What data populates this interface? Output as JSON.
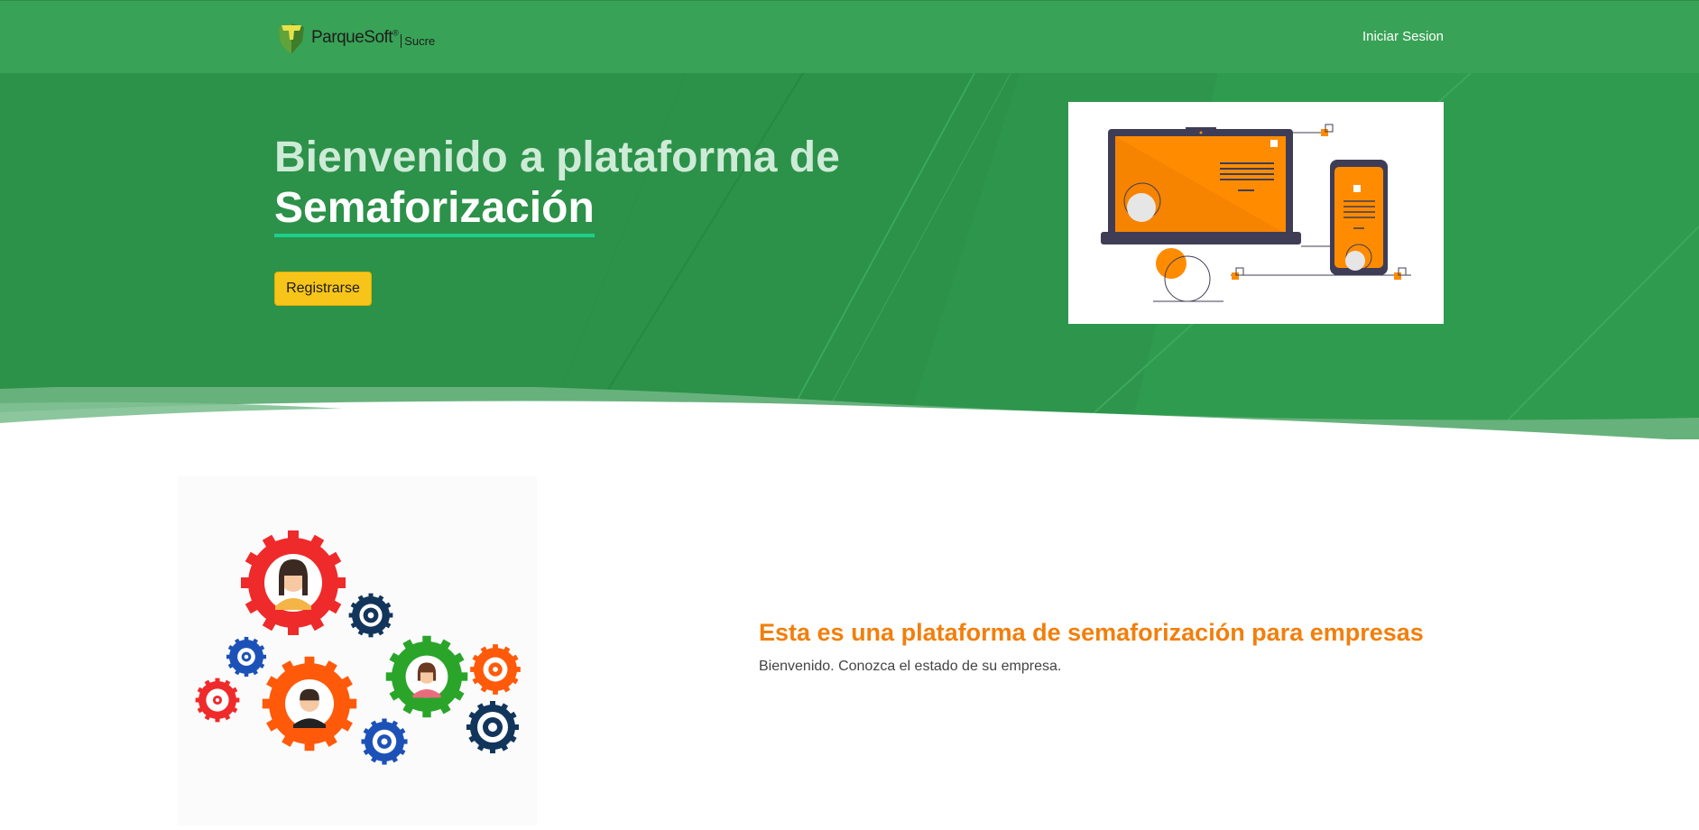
{
  "nav": {
    "brand_name": "ParqueSoft",
    "brand_reg": "®",
    "brand_sub": "Sucre",
    "login_label": "Iniciar Sesion"
  },
  "hero": {
    "title_line1": "Bienvenido a plataforma de",
    "title_line2": "Semaforización",
    "register_label": "Registrarse"
  },
  "info": {
    "title": "Esta es una plataforma de semaforización para empresas",
    "text": "Bienvenido. Conozca el estado de su empresa."
  },
  "colors": {
    "nav_green": "#38a356",
    "hero_green": "#2c9149",
    "accent_orange": "#f27f0c",
    "button_yellow": "#f7c51a",
    "underline_green": "#1ecf8c"
  },
  "icons": [
    "parquesoft-logo-icon",
    "devices-illustration",
    "teamwork-gears-illustration"
  ]
}
